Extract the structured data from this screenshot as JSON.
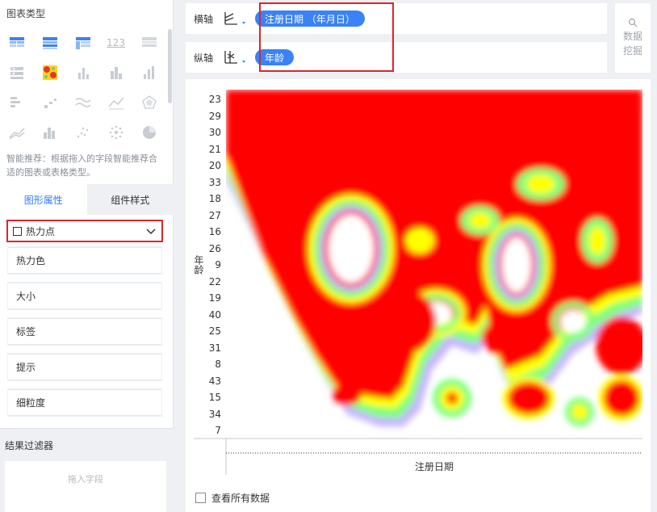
{
  "left_panel": {
    "chart_type_title": "图表类型",
    "chart_types": [
      {
        "icon": "table-icon"
      },
      {
        "icon": "grouped-table-icon"
      },
      {
        "icon": "cross-table-icon"
      },
      {
        "icon": "kpi-icon",
        "label": "123"
      },
      {
        "icon": "detail-table-icon"
      },
      {
        "icon": "filter-table-icon"
      },
      {
        "icon": "heatmap-icon"
      },
      {
        "icon": "dot-bar-icon"
      },
      {
        "icon": "bar-chart-icon"
      },
      {
        "icon": "column-chart-icon"
      },
      {
        "icon": "funnel-icon"
      },
      {
        "icon": "step-icon"
      },
      {
        "icon": "wave-icon"
      },
      {
        "icon": "line-chart-icon"
      },
      {
        "icon": "radar-icon"
      },
      {
        "icon": "area-line-icon"
      },
      {
        "icon": "histogram-icon"
      },
      {
        "icon": "scatter-icon"
      },
      {
        "icon": "bubble-icon"
      },
      {
        "icon": "pie-icon"
      }
    ],
    "hint": "智能推荐：根据拖入的字段智能推荐合适的图表或表格类型。",
    "tabs": [
      {
        "label": "图形属性"
      },
      {
        "label": "组件样式"
      }
    ],
    "mark_type": "热力点",
    "properties": [
      "热力色",
      "大小",
      "标签",
      "提示",
      "细粒度"
    ],
    "filter_title": "结果过滤器",
    "filter_placeholder": "拖入字段"
  },
  "shelf": {
    "x_label": "横轴",
    "x_field": "注册日期 （年月日）",
    "y_label": "纵轴",
    "y_field": "年龄"
  },
  "data_mining": {
    "line1": "数据",
    "line2": "挖掘"
  },
  "chart": {
    "y_axis_title": "年龄",
    "x_axis_title": "注册日期",
    "y_ticks": [
      "23",
      "29",
      "30",
      "21",
      "20",
      "33",
      "18",
      "27",
      "16",
      "26",
      "9",
      "22",
      "19",
      "40",
      "25",
      "31",
      "8",
      "43",
      "15",
      "34",
      "7"
    ]
  },
  "check_all_label": "查看所有数据",
  "colors": {
    "accent": "#3a82f6",
    "highlight": "#e2222a",
    "heat_red": "#ff0000",
    "heat_yellow": "#ffff00",
    "heat_green": "#7dff7d",
    "heat_purple": "#c8b4ff"
  }
}
